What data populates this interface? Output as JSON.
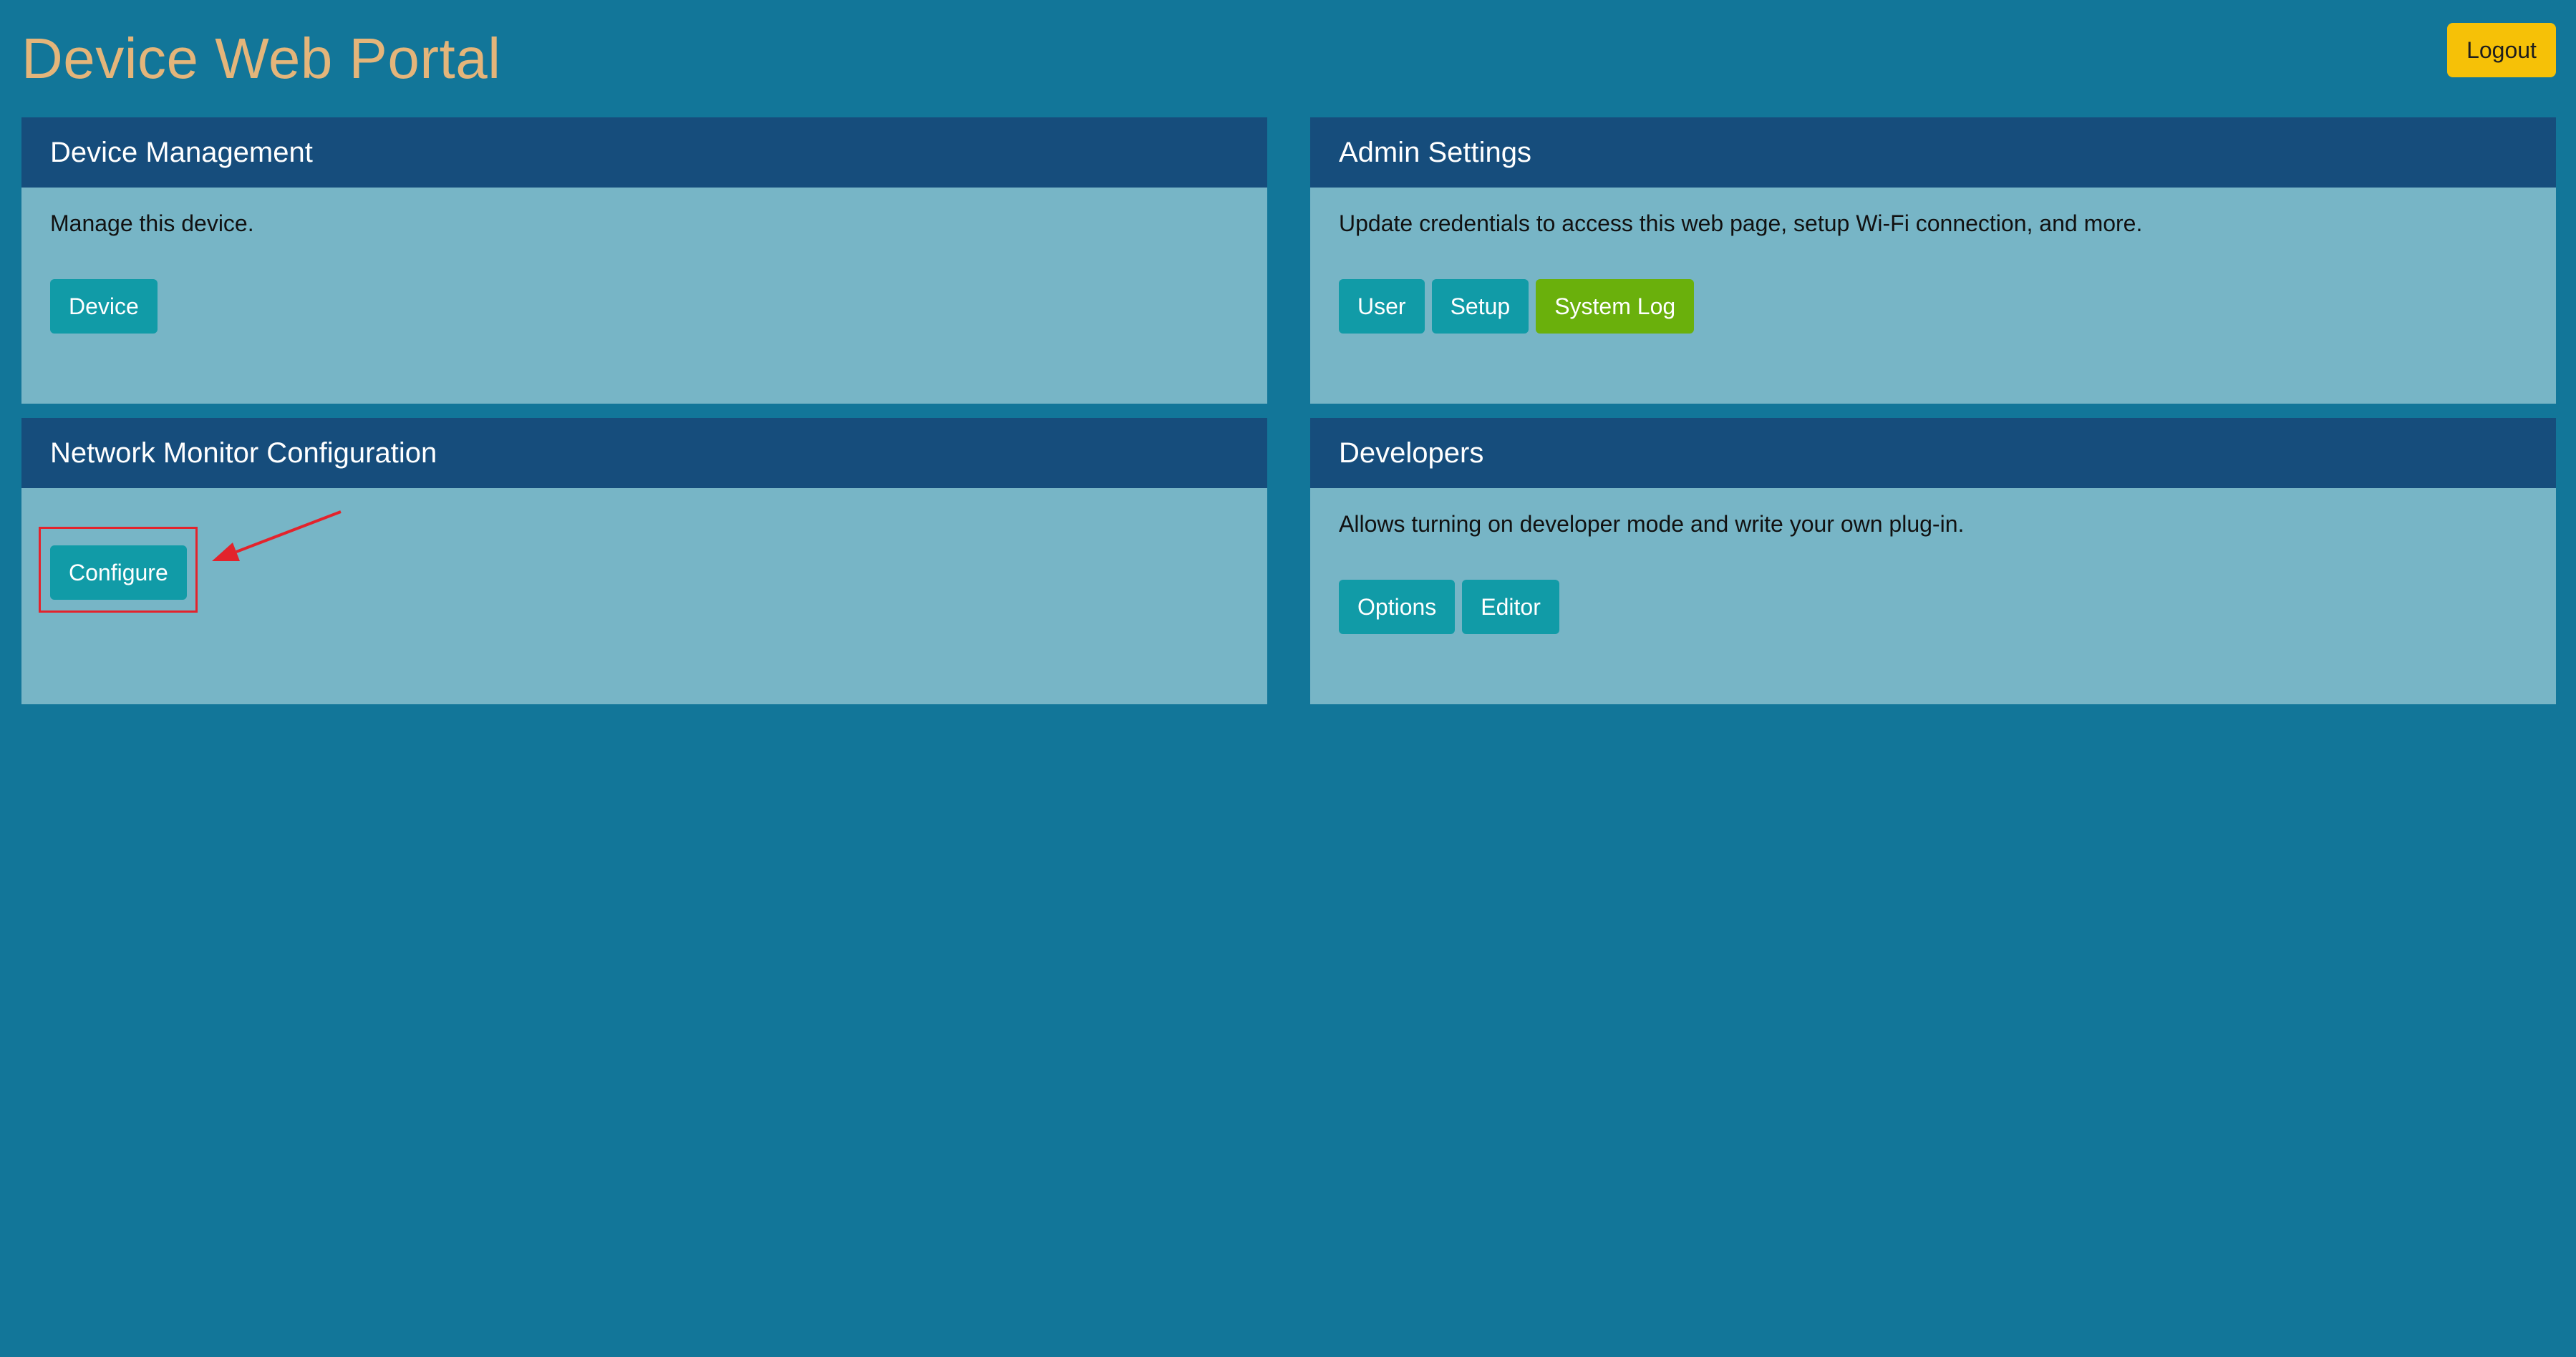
{
  "header": {
    "title": "Device Web Portal",
    "logout_label": "Logout"
  },
  "panels": {
    "device_management": {
      "title": "Device Management",
      "description": "Manage this device.",
      "buttons": [
        "Device"
      ]
    },
    "admin_settings": {
      "title": "Admin Settings",
      "description": "Update credentials to access this web page, setup Wi-Fi connection, and more.",
      "buttons": [
        "User",
        "Setup",
        "System Log"
      ]
    },
    "network_monitor": {
      "title": "Network Monitor Configuration",
      "buttons": [
        "Configure"
      ]
    },
    "developers": {
      "title": "Developers",
      "description": "Allows turning on developer mode and write your own plug-in.",
      "buttons": [
        "Options",
        "Editor"
      ]
    }
  },
  "colors": {
    "background": "#127699",
    "panel_header": "#164d7c",
    "panel_body": "#77b5c6",
    "title": "#e4b57a",
    "button_primary": "#119ba7",
    "button_success": "#6ab00c",
    "button_warning": "#f6c107",
    "annotation": "#e3232c"
  },
  "icons": {
    "annotation_arrow": "red-arrow-icon"
  }
}
